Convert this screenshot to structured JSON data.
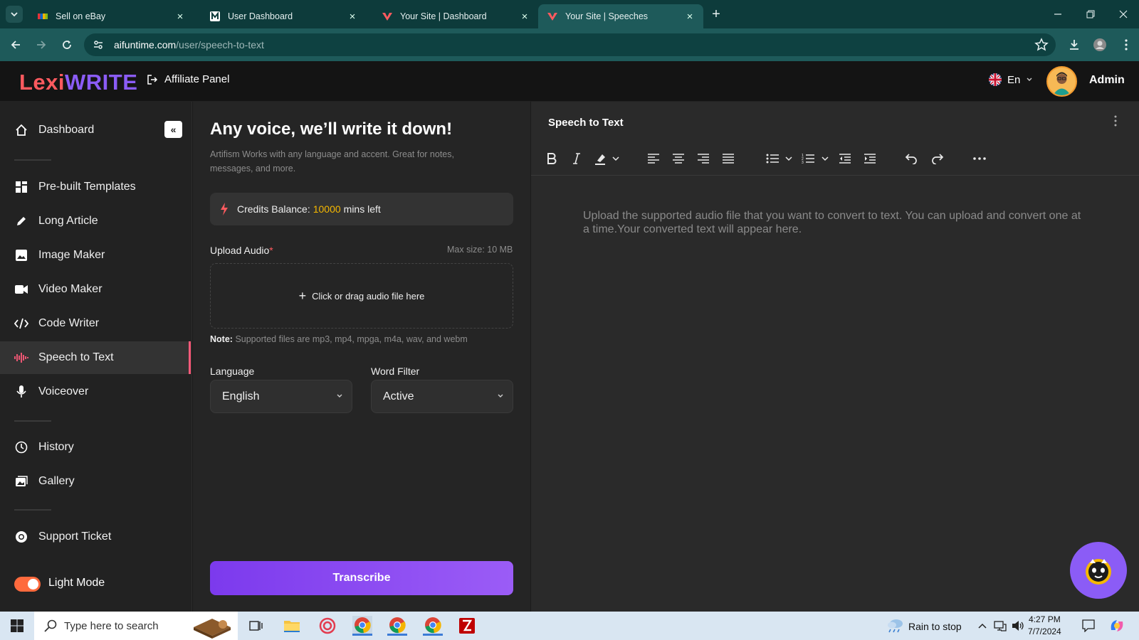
{
  "browser": {
    "tabs": [
      {
        "title": "Sell on eBay",
        "active": false
      },
      {
        "title": "User Dashboard",
        "active": false
      },
      {
        "title": "Your Site | Dashboard",
        "active": false
      },
      {
        "title": "Your Site | Speeches",
        "active": true
      }
    ],
    "url_domain": "aifuntime.com",
    "url_path": "/user/speech-to-text"
  },
  "header": {
    "logo_part1": "Lexi",
    "logo_part2": "WRITE",
    "affiliate_label": "Affiliate Panel",
    "language": "En",
    "user_name": "Admin"
  },
  "sidebar": {
    "items": [
      {
        "label": "Dashboard",
        "icon": "home-icon"
      },
      {
        "label": "Pre-built Templates",
        "icon": "grid-icon"
      },
      {
        "label": "Long Article",
        "icon": "pen-icon"
      },
      {
        "label": "Image Maker",
        "icon": "image-icon"
      },
      {
        "label": "Video Maker",
        "icon": "video-icon"
      },
      {
        "label": "Code Writer",
        "icon": "code-icon"
      },
      {
        "label": "Speech to Text",
        "icon": "waveform-icon"
      },
      {
        "label": "Voiceover",
        "icon": "microphone-icon"
      },
      {
        "label": "History",
        "icon": "history-icon"
      },
      {
        "label": "Gallery",
        "icon": "gallery-icon"
      },
      {
        "label": "Support Ticket",
        "icon": "support-icon"
      }
    ],
    "light_mode_label": "Light Mode",
    "active_item": "Speech to Text",
    "collapse_glyph": "«"
  },
  "panel": {
    "title": "Any voice, we’ll write it down!",
    "subtitle": "Artifism Works with any language and accent. Great for notes, messages, and more.",
    "credits_label": "Credits Balance:",
    "credits_value": "10000",
    "credits_suffix": "mins left",
    "upload_label": "Upload Audio",
    "upload_required": "*",
    "max_size": "Max size: 10 MB",
    "drop_text": "Click or drag audio file here",
    "note_label": "Note:",
    "note_text": "Supported files are mp3, mp4, mpga, m4a, wav, and webm",
    "language_label": "Language",
    "language_value": "English",
    "word_filter_label": "Word Filter",
    "word_filter_value": "Active",
    "transcribe_label": "Transcribe"
  },
  "editor": {
    "title": "Speech to Text",
    "placeholder": "Upload the supported audio file that you want to convert to text. You can upload and convert one at a time.Your converted text will appear here."
  },
  "taskbar": {
    "search_placeholder": "Type here to search",
    "weather": "Rain to stop",
    "time": "4:27 PM",
    "date": "7/7/2024"
  },
  "colors": {
    "accent_purple": "#8b5cf6",
    "accent_red": "#ff5a5f",
    "credits_yellow": "#f5b800",
    "toggle_orange": "#ff6a3d"
  }
}
